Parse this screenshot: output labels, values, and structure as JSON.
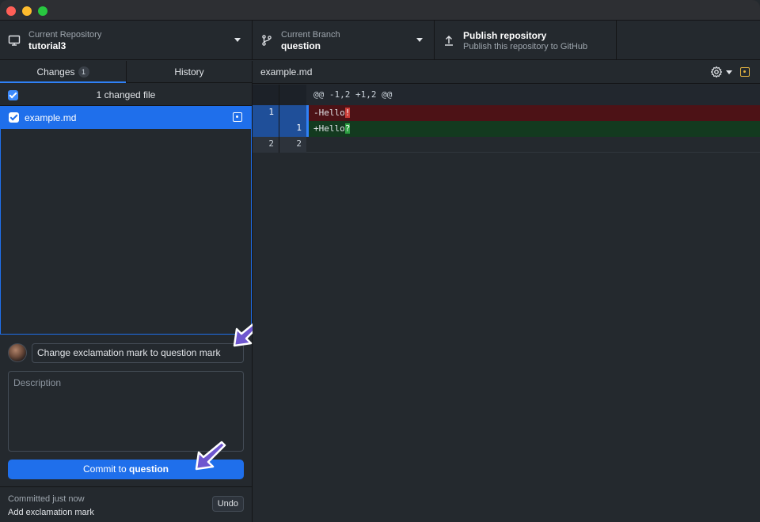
{
  "window": {
    "traffic_lights": {
      "close": "#ff5f57",
      "minimize": "#febc2e",
      "zoom": "#28c840"
    }
  },
  "toolbar": {
    "repo": {
      "caption": "Current Repository",
      "value": "tutorial3",
      "icon": "desktop-icon"
    },
    "branch": {
      "caption": "Current Branch",
      "value": "question",
      "icon": "git-branch-icon"
    },
    "publish": {
      "title": "Publish repository",
      "subtitle": "Publish this repository to GitHub",
      "icon": "upload-icon"
    }
  },
  "sidebar": {
    "tabs": [
      {
        "label": "Changes",
        "badge": "1",
        "active": true
      },
      {
        "label": "History",
        "active": false
      }
    ],
    "changed_files_label": "1 changed file",
    "files": [
      {
        "name": "example.md",
        "checked": true,
        "status": "modified"
      }
    ]
  },
  "commit": {
    "summary_value": "Change exclamation mark to question mark",
    "description_placeholder": "Description",
    "button_prefix": "Commit to ",
    "button_branch": "question"
  },
  "last_commit": {
    "when": "Committed just now",
    "message": "Add exclamation mark",
    "undo_label": "Undo"
  },
  "diff": {
    "filename": "example.md",
    "hunk_header": "@@ -1,2 +1,2 @@",
    "lines": [
      {
        "type": "del",
        "old": "1",
        "new": "",
        "prefix": "-Hello",
        "highlight": "!"
      },
      {
        "type": "add",
        "old": "",
        "new": "1",
        "prefix": "+Hello",
        "highlight": "?"
      },
      {
        "type": "ctx",
        "old": "2",
        "new": "2",
        "text": ""
      }
    ]
  },
  "colors": {
    "accent": "#1f6feb",
    "deleted_bg": "#4d1216",
    "added_bg": "#133a1f",
    "modified_icon": "#e3b341",
    "annotation_arrow": "#6e56cf"
  }
}
